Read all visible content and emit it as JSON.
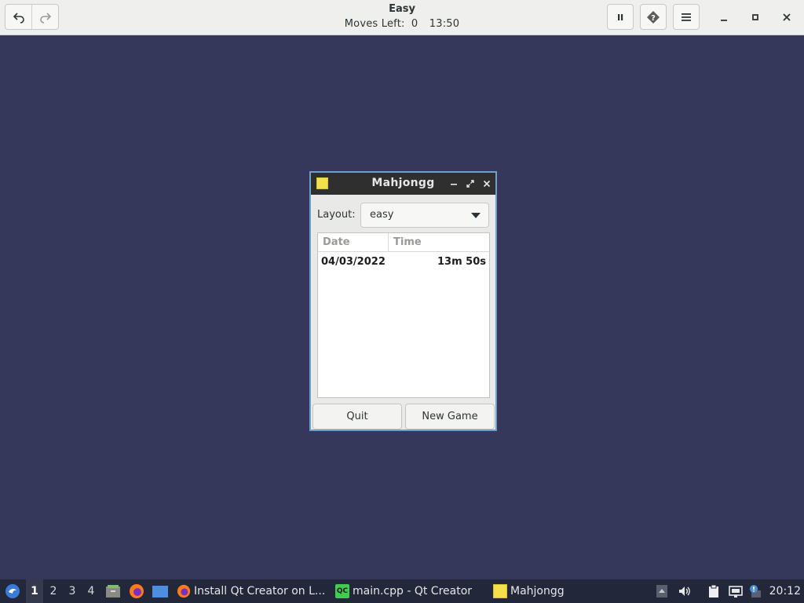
{
  "header": {
    "title": "Easy",
    "moves_label": "Moves Left:",
    "moves_value": "0",
    "elapsed": "13:50",
    "icons": [
      "undo-icon",
      "redo-icon",
      "pause-icon",
      "hint-icon",
      "menu-icon",
      "minimize-icon",
      "maximize-icon",
      "close-icon"
    ]
  },
  "dialog": {
    "title": "Mahjongg",
    "layout_label": "Layout:",
    "layout_value": "easy",
    "columns": [
      "Date",
      "Time"
    ],
    "rows": [
      {
        "date": "04/03/2022",
        "time": "13m 50s"
      }
    ],
    "quit_label": "Quit",
    "new_game_label": "New Game",
    "icon_color": "#f4e04d"
  },
  "taskbar": {
    "workspaces": [
      "1",
      "2",
      "3",
      "4"
    ],
    "active_workspace": "1",
    "tasks": [
      {
        "label": "Install Qt Creator on L...",
        "icon": "firefox-icon"
      },
      {
        "label": "main.cpp - Qt Creator",
        "icon": "qt-creator-icon",
        "icon_text": "QC"
      },
      {
        "label": "Mahjongg",
        "icon": "mahjongg-icon"
      }
    ],
    "clock": "20:12"
  },
  "colors": {
    "desktop": "#35375b",
    "accent_border": "#6d9fd0",
    "taskbar": "#22273a"
  }
}
